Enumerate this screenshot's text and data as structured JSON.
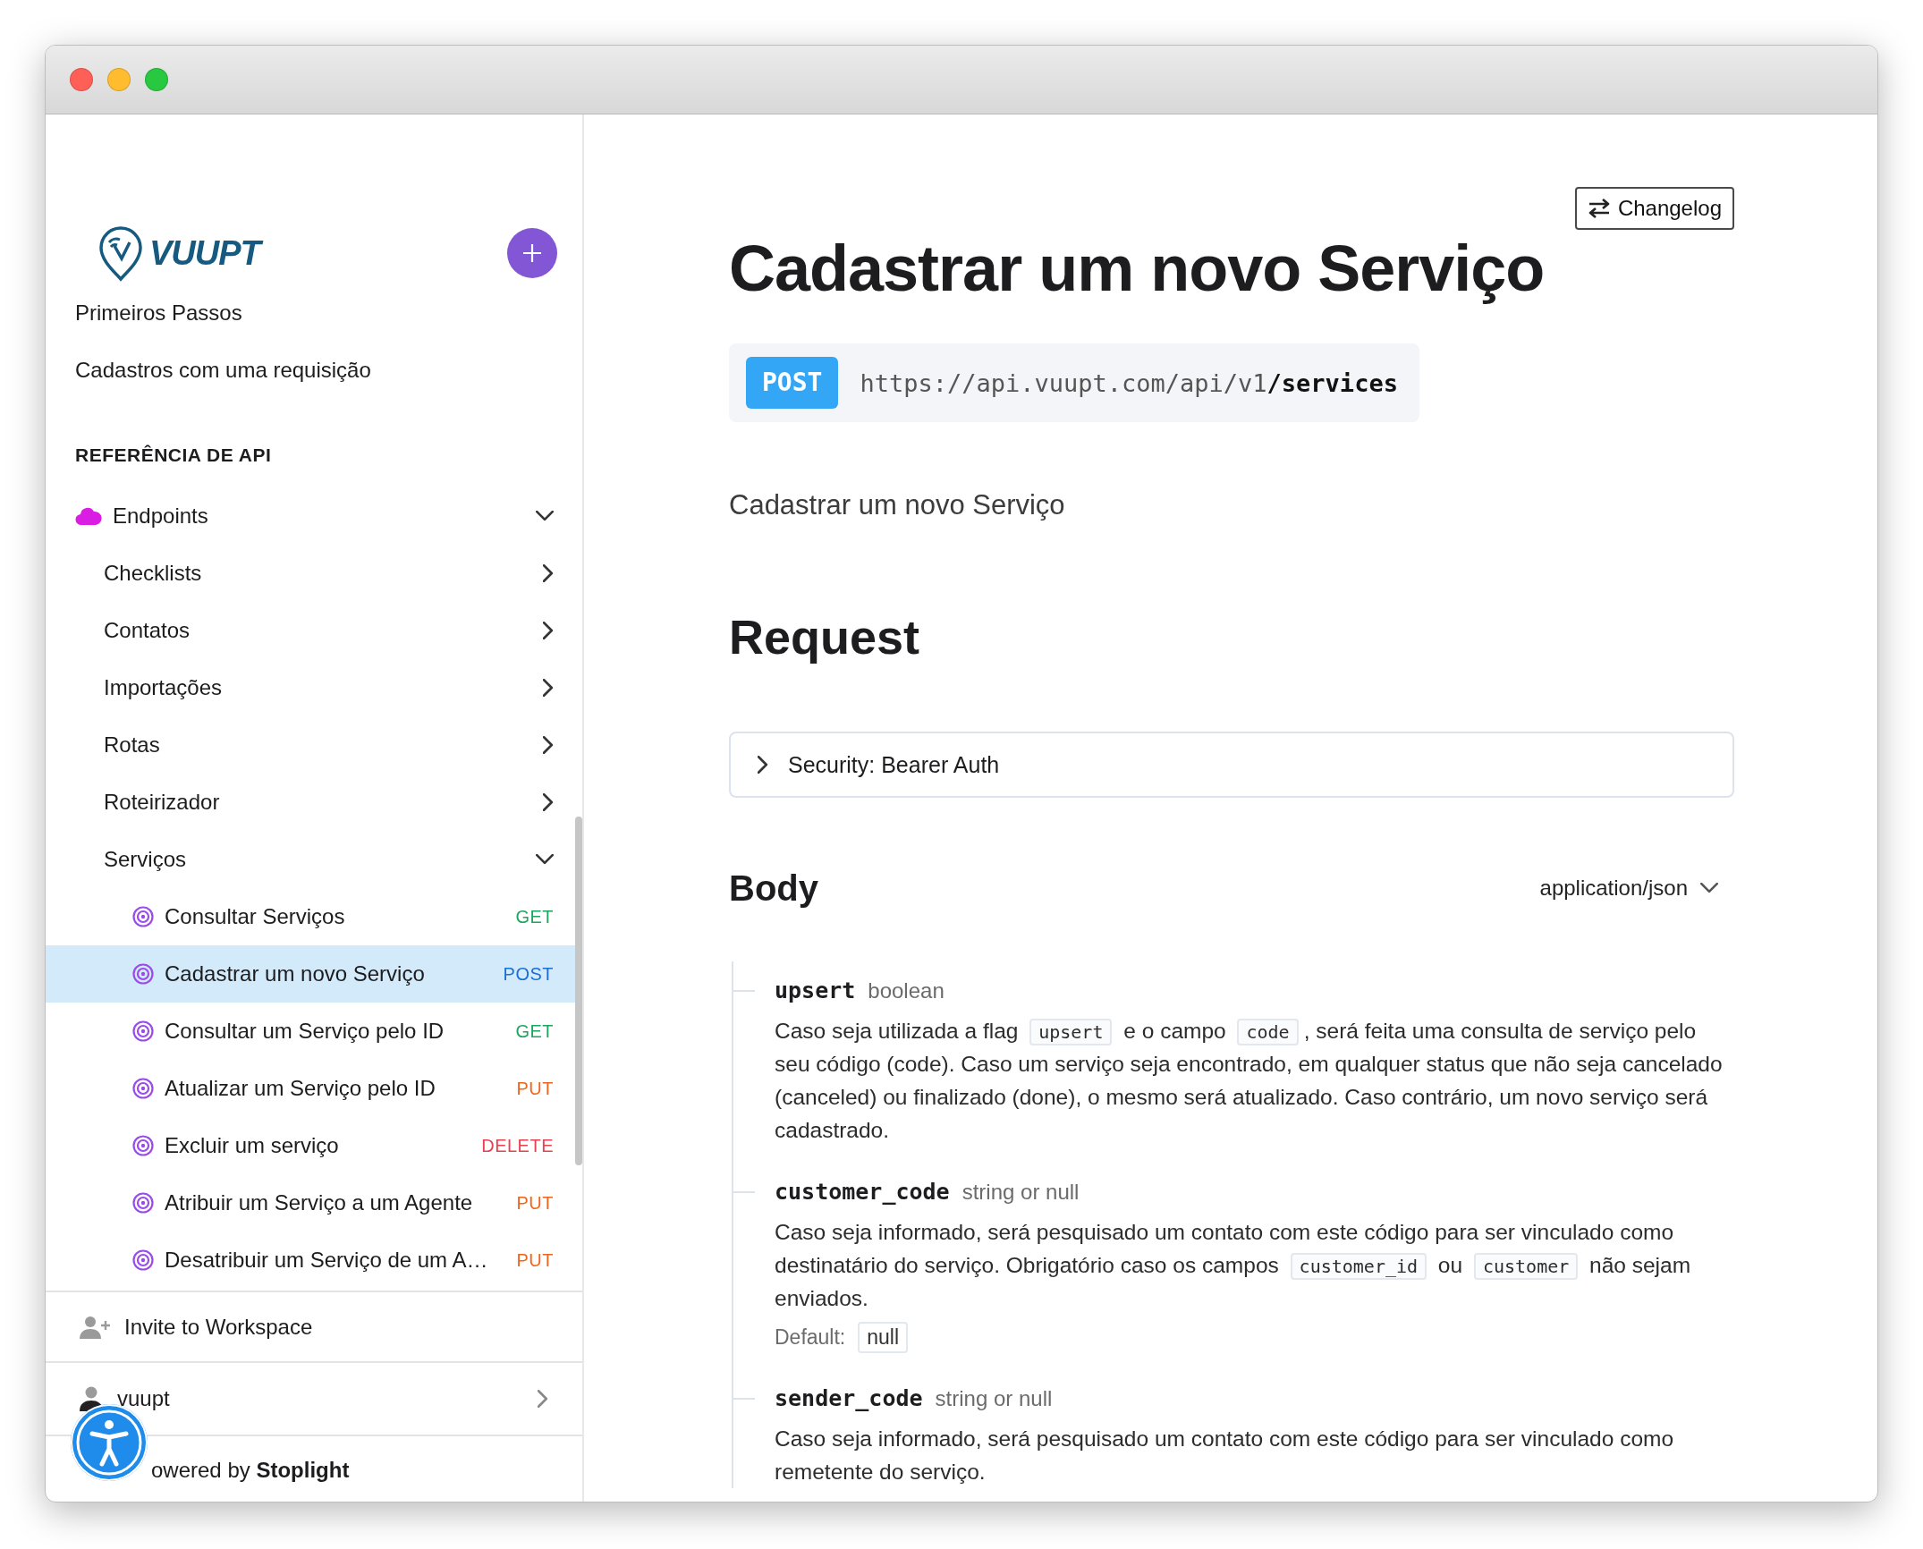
{
  "sidebar": {
    "logo": {
      "text": "VUUPT"
    },
    "nav": [
      {
        "kind": "link",
        "label": "Primeiros Passos"
      },
      {
        "kind": "link",
        "label": "Cadastros com uma requisição"
      },
      {
        "kind": "heading",
        "label": "REFERÊNCIA DE API"
      },
      {
        "kind": "group",
        "label": "Endpoints",
        "expanded": true,
        "children": [
          {
            "kind": "group",
            "label": "Checklists",
            "expanded": false
          },
          {
            "kind": "group",
            "label": "Contatos",
            "expanded": false
          },
          {
            "kind": "group",
            "label": "Importações",
            "expanded": false
          },
          {
            "kind": "group",
            "label": "Rotas",
            "expanded": false
          },
          {
            "kind": "group",
            "label": "Roteirizador",
            "expanded": false
          },
          {
            "kind": "group",
            "label": "Serviços",
            "expanded": true,
            "children": [
              {
                "kind": "endpoint",
                "label": "Consultar Serviços",
                "method": "GET",
                "color": "#1ea65e",
                "selected": false
              },
              {
                "kind": "endpoint",
                "label": "Cadastrar um novo Serviço",
                "method": "POST",
                "color": "#1a6fd6",
                "selected": true
              },
              {
                "kind": "endpoint",
                "label": "Consultar um Serviço pelo ID",
                "method": "GET",
                "color": "#1ea65e",
                "selected": false
              },
              {
                "kind": "endpoint",
                "label": "Atualizar um Serviço pelo ID",
                "method": "PUT",
                "color": "#f2661c",
                "selected": false
              },
              {
                "kind": "endpoint",
                "label": "Excluir um serviço",
                "method": "DELETE",
                "color": "#e8414f",
                "selected": false
              },
              {
                "kind": "endpoint",
                "label": "Atribuir um Serviço a um Agente",
                "method": "PUT",
                "color": "#f2661c",
                "selected": false
              },
              {
                "kind": "endpoint",
                "label": "Desatribuir um Serviço de um A…",
                "method": "PUT",
                "color": "#f2661c",
                "selected": false
              }
            ]
          }
        ]
      }
    ],
    "footer": [
      {
        "kind": "invite",
        "label": "Invite to Workspace"
      },
      {
        "kind": "workspace",
        "label": "vuupt"
      },
      {
        "kind": "powered",
        "label": "owered by **Stoplight**"
      }
    ]
  },
  "main": {
    "changelog_button": "Changelog",
    "title": "Cadastrar um novo Serviço",
    "endpoint": {
      "method": "POST",
      "url": "https://api.vuupt.com/api/v1**/services**"
    },
    "description": "Cadastrar um novo Serviço",
    "request_heading": "Request",
    "security": {
      "label": "Security: Bearer Auth",
      "expanded": false
    },
    "body": {
      "heading": "Body",
      "content_type": "application/json",
      "default_label": "Default:",
      "fields": [
        {
          "name": "upsert",
          "type": "boolean",
          "description": [
            {
              "kind": "text",
              "text": "Caso seja utilizada a flag "
            },
            {
              "kind": "code",
              "text": "upsert"
            },
            {
              "kind": "text",
              "text": " e o campo "
            },
            {
              "kind": "code",
              "text": "code"
            },
            {
              "kind": "text",
              "text": ", será feita uma consulta de serviço pelo seu código (code). Caso um serviço seja encontrado, em qualquer status que não seja cancelado (canceled) ou finalizado (done), o mesmo será atualizado. Caso contrário, um novo serviço será cadastrado."
            }
          ]
        },
        {
          "name": "customer_code",
          "type": "string or null",
          "description": [
            {
              "kind": "text",
              "text": "Caso seja informado, será pesquisado um contato com este código para ser vinculado como destinatário do serviço. Obrigatório caso os campos "
            },
            {
              "kind": "code",
              "text": "customer_id"
            },
            {
              "kind": "text",
              "text": " ou "
            },
            {
              "kind": "code",
              "text": "customer"
            },
            {
              "kind": "text",
              "text": " não sejam enviados."
            }
          ],
          "default": "null"
        },
        {
          "name": "sender_code",
          "type": "string or null",
          "description": [
            {
              "kind": "text",
              "text": "Caso seja informado, será pesquisado um contato com este código para ser vinculado como remetente do serviço."
            }
          ]
        }
      ]
    }
  }
}
